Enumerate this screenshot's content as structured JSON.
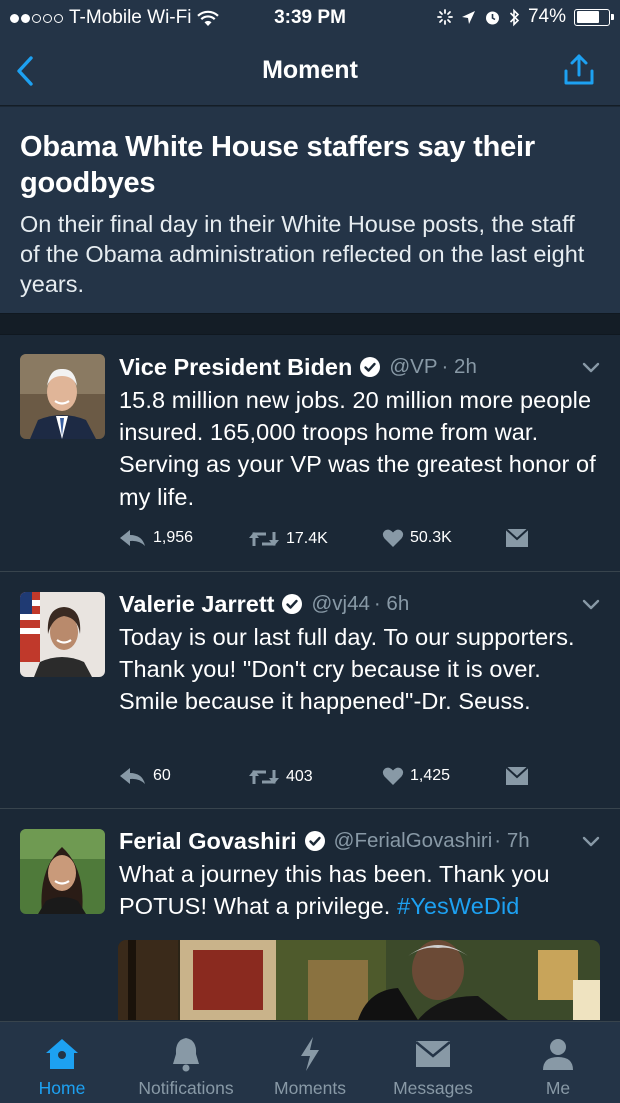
{
  "status_bar": {
    "carrier": "T-Mobile Wi-Fi",
    "time": "3:39 PM",
    "battery": "74%",
    "battery_level": 0.74
  },
  "nav": {
    "title": "Moment",
    "back_icon": "chevron-left-icon",
    "share_icon": "share-icon"
  },
  "moment": {
    "title": "Obama White House staffers say their goodbyes",
    "description": "On their final day in their White House posts, the staff of the Obama administration reflected on the last eight years."
  },
  "tweets": [
    {
      "name": "Vice President Biden",
      "handle": "@VP",
      "time": "· 2h",
      "text": "15.8 million new jobs. 20 million more people insured. 165,000 troops home from war. Serving as your VP was the greatest honor of my life.",
      "replies": "1,956",
      "retweets": "17.4K",
      "likes": "50.3K"
    },
    {
      "name": "Valerie Jarrett",
      "handle": "@vj44",
      "time": "· 6h",
      "text": "Today is our last full day. To our supporters. Thank you!  \"Don't cry because it is over. Smile because it happened\"-Dr. Seuss.",
      "replies": "60",
      "retweets": "403",
      "likes": "1,425"
    },
    {
      "name": "Ferial Govashiri",
      "handle": "@FerialGovashiri",
      "time": "· 7h",
      "text": "What a journey this has been. Thank you POTUS! What a privilege.",
      "hashtag": "#YesWeDid"
    }
  ],
  "tab_bar": {
    "items": [
      {
        "label": "Home",
        "icon": "home-icon",
        "active": true
      },
      {
        "label": "Notifications",
        "icon": "bell-icon",
        "active": false
      },
      {
        "label": "Moments",
        "icon": "lightning-icon",
        "active": false
      },
      {
        "label": "Messages",
        "icon": "envelope-icon",
        "active": false
      },
      {
        "label": "Me",
        "icon": "person-icon",
        "active": false
      }
    ]
  },
  "colors": {
    "background": "#1b2836",
    "bar": "#243447",
    "accent": "#1da1f2",
    "secondary_text": "#8899a6"
  }
}
